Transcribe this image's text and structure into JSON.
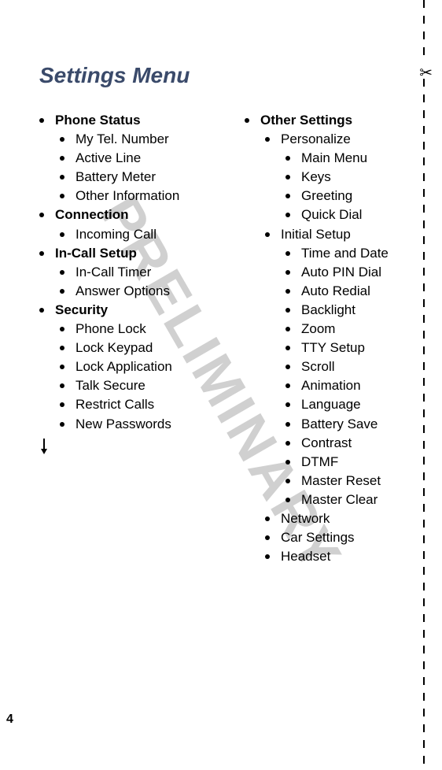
{
  "watermark": "PRELIMINARY",
  "title": "Settings Menu",
  "page_number": "4",
  "scissors_glyph": "✂",
  "columns": {
    "left": [
      {
        "text": "Phone Status",
        "level": 1,
        "bold": true
      },
      {
        "text": "My Tel. Number",
        "level": 2,
        "bold": false
      },
      {
        "text": "Active Line",
        "level": 2,
        "bold": false
      },
      {
        "text": "Battery Meter",
        "level": 2,
        "bold": false
      },
      {
        "text": "Other Information",
        "level": 2,
        "bold": false
      },
      {
        "text": "Connection",
        "level": 1,
        "bold": true
      },
      {
        "text": "Incoming Call",
        "level": 2,
        "bold": false
      },
      {
        "text": "In-Call Setup",
        "level": 1,
        "bold": true
      },
      {
        "text": "In-Call Timer",
        "level": 2,
        "bold": false
      },
      {
        "text": "Answer Options",
        "level": 2,
        "bold": false
      },
      {
        "text": "Security",
        "level": 1,
        "bold": true
      },
      {
        "text": "Phone Lock",
        "level": 2,
        "bold": false
      },
      {
        "text": "Lock Keypad",
        "level": 2,
        "bold": false
      },
      {
        "text": "Lock Application",
        "level": 2,
        "bold": false
      },
      {
        "text": "Talk Secure",
        "level": 2,
        "bold": false
      },
      {
        "text": "Restrict Calls",
        "level": 2,
        "bold": false
      },
      {
        "text": "New Passwords",
        "level": 2,
        "bold": false
      }
    ],
    "right": [
      {
        "text": "Other Settings",
        "level": 1,
        "bold": true
      },
      {
        "text": "Personalize",
        "level": 2,
        "bold": false
      },
      {
        "text": "Main Menu",
        "level": 3,
        "bold": false
      },
      {
        "text": "Keys",
        "level": 3,
        "bold": false
      },
      {
        "text": "Greeting",
        "level": 3,
        "bold": false
      },
      {
        "text": "Quick Dial",
        "level": 3,
        "bold": false
      },
      {
        "text": "Initial Setup",
        "level": 2,
        "bold": false
      },
      {
        "text": "Time and Date",
        "level": 3,
        "bold": false
      },
      {
        "text": "Auto PIN Dial",
        "level": 3,
        "bold": false
      },
      {
        "text": "Auto Redial",
        "level": 3,
        "bold": false
      },
      {
        "text": "Backlight",
        "level": 3,
        "bold": false
      },
      {
        "text": "Zoom",
        "level": 3,
        "bold": false
      },
      {
        "text": "TTY Setup",
        "level": 3,
        "bold": false
      },
      {
        "text": "Scroll",
        "level": 3,
        "bold": false
      },
      {
        "text": "Animation",
        "level": 3,
        "bold": false
      },
      {
        "text": "Language",
        "level": 3,
        "bold": false
      },
      {
        "text": "Battery Save",
        "level": 3,
        "bold": false
      },
      {
        "text": "Contrast",
        "level": 3,
        "bold": false
      },
      {
        "text": "DTMF",
        "level": 3,
        "bold": false
      },
      {
        "text": "Master Reset",
        "level": 3,
        "bold": false
      },
      {
        "text": "Master Clear",
        "level": 3,
        "bold": false
      },
      {
        "text": "Network",
        "level": 2,
        "bold": false
      },
      {
        "text": "Car Settings",
        "level": 2,
        "bold": false
      },
      {
        "text": "Headset",
        "level": 2,
        "bold": false
      }
    ]
  }
}
